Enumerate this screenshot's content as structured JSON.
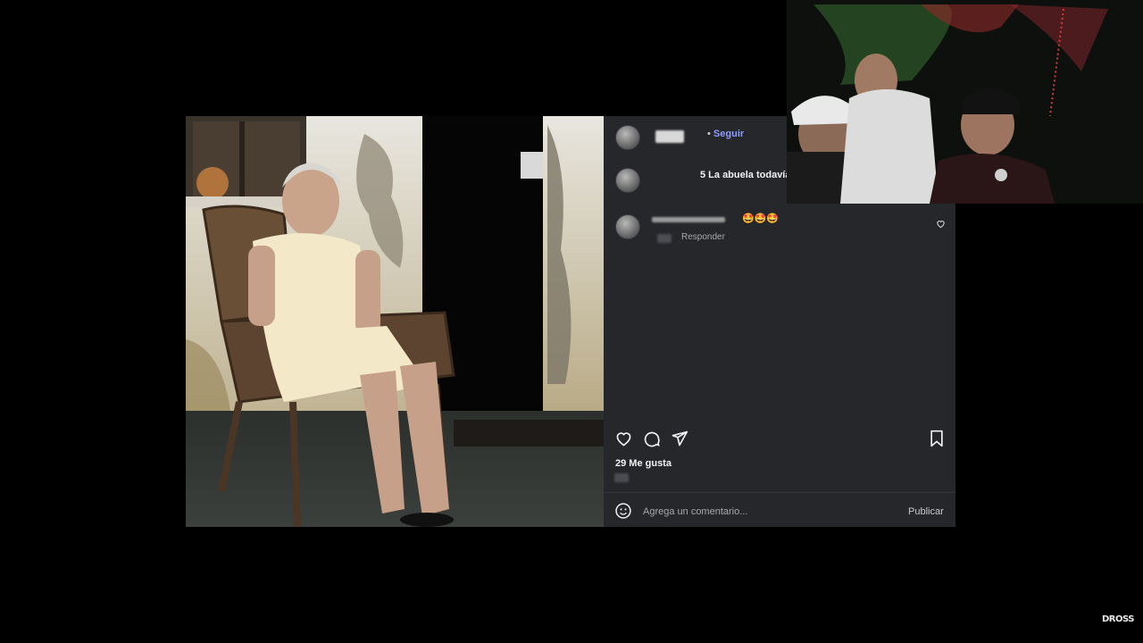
{
  "post": {
    "author_action": "Seguir",
    "caption_text": "5 La abuela todavía",
    "comment_emojis": "🤩🤩🤩",
    "reply_label": "Responder",
    "likes_text": "29 Me gusta",
    "comment_placeholder": "Agrega un comentario...",
    "publish_label": "Publicar"
  },
  "colors": {
    "panel_bg": "#25272b",
    "accent_link": "#8f9bff",
    "page_bg": "#000000"
  },
  "icons": {
    "like": "heart-icon",
    "comment": "comment-icon",
    "share": "send-icon",
    "save": "bookmark-icon",
    "emoji": "emoji-icon",
    "comment_like": "small-heart-icon"
  },
  "watermark": "DROSS"
}
